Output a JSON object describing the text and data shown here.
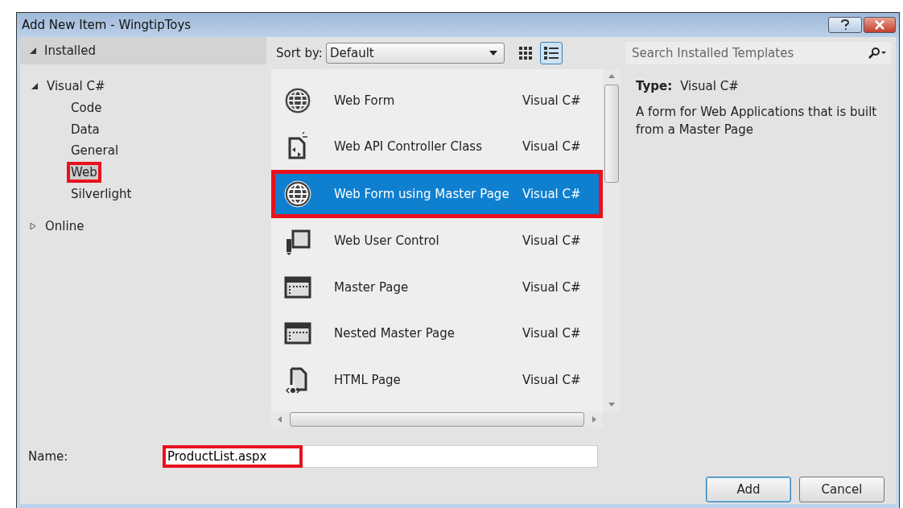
{
  "window": {
    "title": "Add New Item - WingtipToys"
  },
  "tree": {
    "header": {
      "label": "Installed",
      "expanded": true
    },
    "items": [
      {
        "label": "Visual C#",
        "expanded": true,
        "selected": false,
        "highlighted": false,
        "children": [
          {
            "label": "Code",
            "selected": false,
            "highlighted": false
          },
          {
            "label": "Data",
            "selected": false,
            "highlighted": false
          },
          {
            "label": "General",
            "selected": false,
            "highlighted": false
          },
          {
            "label": "Web",
            "selected": true,
            "highlighted": true
          },
          {
            "label": "Silverlight",
            "selected": false,
            "highlighted": false
          }
        ]
      },
      {
        "label": "Online",
        "expanded": false,
        "selected": false,
        "highlighted": false
      }
    ]
  },
  "toolbar": {
    "sort_label": "Sort by:",
    "sort_value": "Default",
    "views": [
      {
        "kind": "grid",
        "selected": false
      },
      {
        "kind": "list",
        "selected": true
      }
    ]
  },
  "search": {
    "placeholder": "Search Installed Templates"
  },
  "templates": [
    {
      "kind": "globe",
      "name": "Web Form",
      "language": "Visual C#",
      "selected": false,
      "highlighted": false
    },
    {
      "kind": "api",
      "name": "Web API Controller Class",
      "language": "Visual C#",
      "selected": false,
      "highlighted": false
    },
    {
      "kind": "globe",
      "name": "Web Form using Master Page",
      "language": "Visual C#",
      "selected": true,
      "highlighted": true
    },
    {
      "kind": "control",
      "name": "Web User Control",
      "language": "Visual C#",
      "selected": false,
      "highlighted": false
    },
    {
      "kind": "master",
      "name": "Master Page",
      "language": "Visual C#",
      "selected": false,
      "highlighted": false
    },
    {
      "kind": "master",
      "name": "Nested Master Page",
      "language": "Visual C#",
      "selected": false,
      "highlighted": false
    },
    {
      "kind": "html",
      "name": "HTML Page",
      "language": "Visual C#",
      "selected": false,
      "highlighted": false
    }
  ],
  "details": {
    "type_label": "Type:",
    "type_value": "Visual C#",
    "description": "A form for Web Applications that is built from a Master Page"
  },
  "name_field": {
    "label": "Name:",
    "value": "ProductList.aspx",
    "highlighted": true
  },
  "buttons": [
    {
      "label": "Add",
      "default": true
    },
    {
      "label": "Cancel",
      "default": false
    }
  ]
}
